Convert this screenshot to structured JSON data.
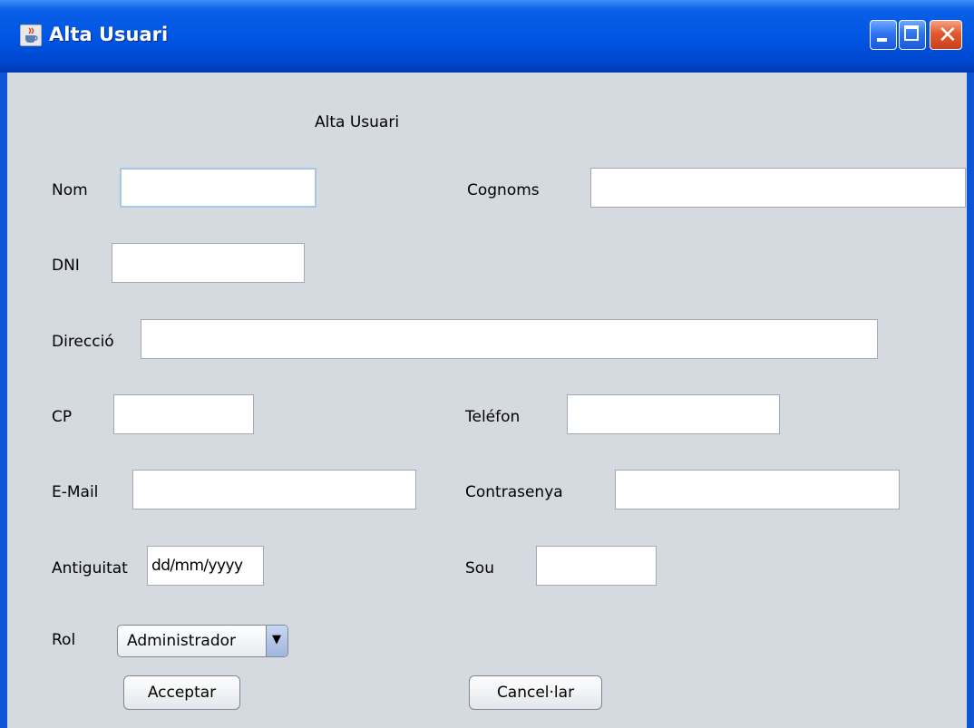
{
  "window": {
    "title": "Alta Usuari",
    "icon": "java-cup-icon",
    "controls": [
      "minimize-icon",
      "maximize-icon",
      "close-icon"
    ]
  },
  "form": {
    "heading": "Alta Usuari",
    "labels": {
      "nom": "Nom",
      "cognoms": "Cognoms",
      "dni": "DNI",
      "direccio": "Direcció",
      "cp": "CP",
      "telefon": "Teléfon",
      "email": "E-Mail",
      "contrasenya": "Contrasenya",
      "antiguitat": "Antiguitat",
      "sou": "Sou",
      "rol": "Rol"
    },
    "values": {
      "nom": "",
      "cognoms": "",
      "dni": "",
      "direccio": "",
      "cp": "",
      "telefon": "",
      "email": "",
      "contrasenya": "",
      "antiguitat": "dd/mm/yyyy",
      "sou": ""
    },
    "rol_selected": "Administrador",
    "buttons": {
      "accept": "Acceptar",
      "cancel": "Cancel·lar"
    }
  },
  "colors": {
    "titlebar": "#0054e3",
    "panel": "#d5d9e0",
    "close_button": "#e2582f"
  }
}
